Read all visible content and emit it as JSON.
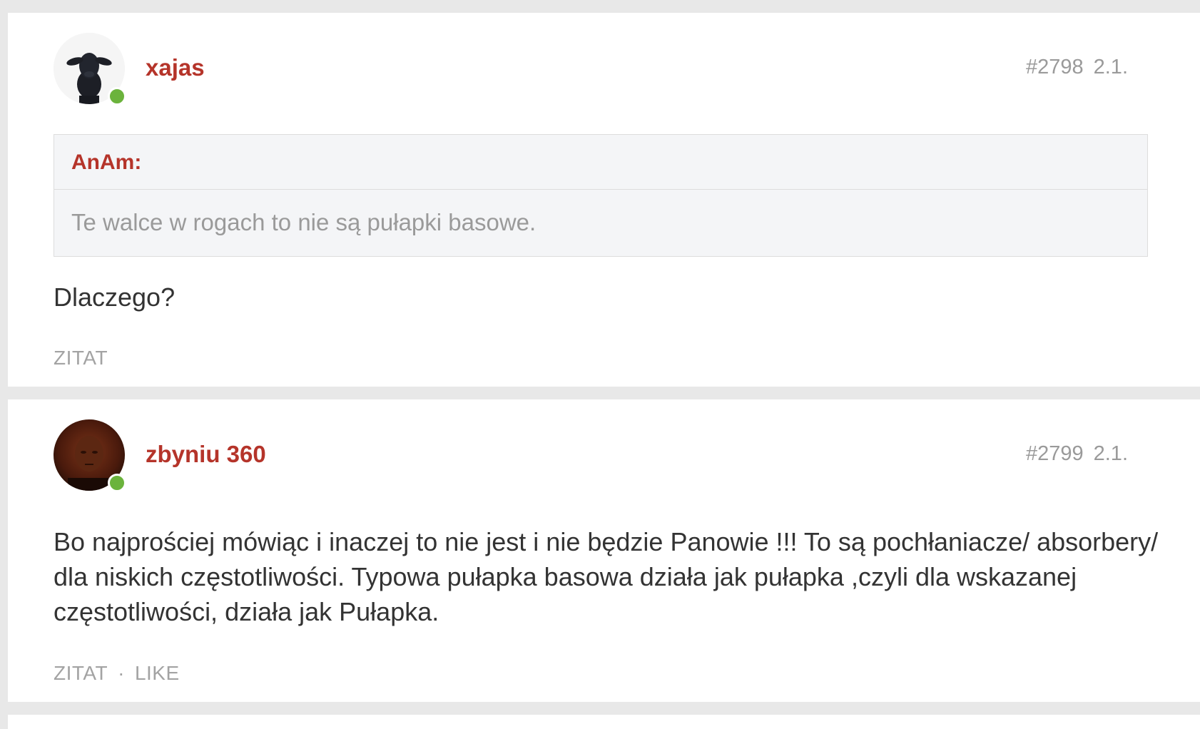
{
  "posts": [
    {
      "username": "xajas",
      "post_number": "#2798",
      "date": "2.1.",
      "avatar_icon": "black-sheep-avatar",
      "online_color": "#6bb33c",
      "quote": {
        "author": "AnAm:",
        "text": "Te walce w rogach to nie są pułapki basowe."
      },
      "body": "Dlaczego?",
      "actions": {
        "quote_label": "ZITAT"
      }
    },
    {
      "username": "zbyniu 360",
      "post_number": "#2799",
      "date": "2.1.",
      "avatar_icon": "user-photo-avatar",
      "online_color": "#6bb33c",
      "body": "Bo najprościej mówiąc i inaczej to nie jest i nie będzie Panowie !!! To są pochłaniacze/ absorbery/ dla niskich częstotliwości. Typowa pułapka basowa działa jak pułapka ,czyli dla wskazanej częstotliwości, działa jak Pułapka.",
      "actions": {
        "quote_label": "ZITAT",
        "separator": "·",
        "like_label": "LIKE"
      }
    }
  ],
  "colors": {
    "username": "#b5342a",
    "meta": "#9a9a9a",
    "background": "#e8e8e8"
  }
}
